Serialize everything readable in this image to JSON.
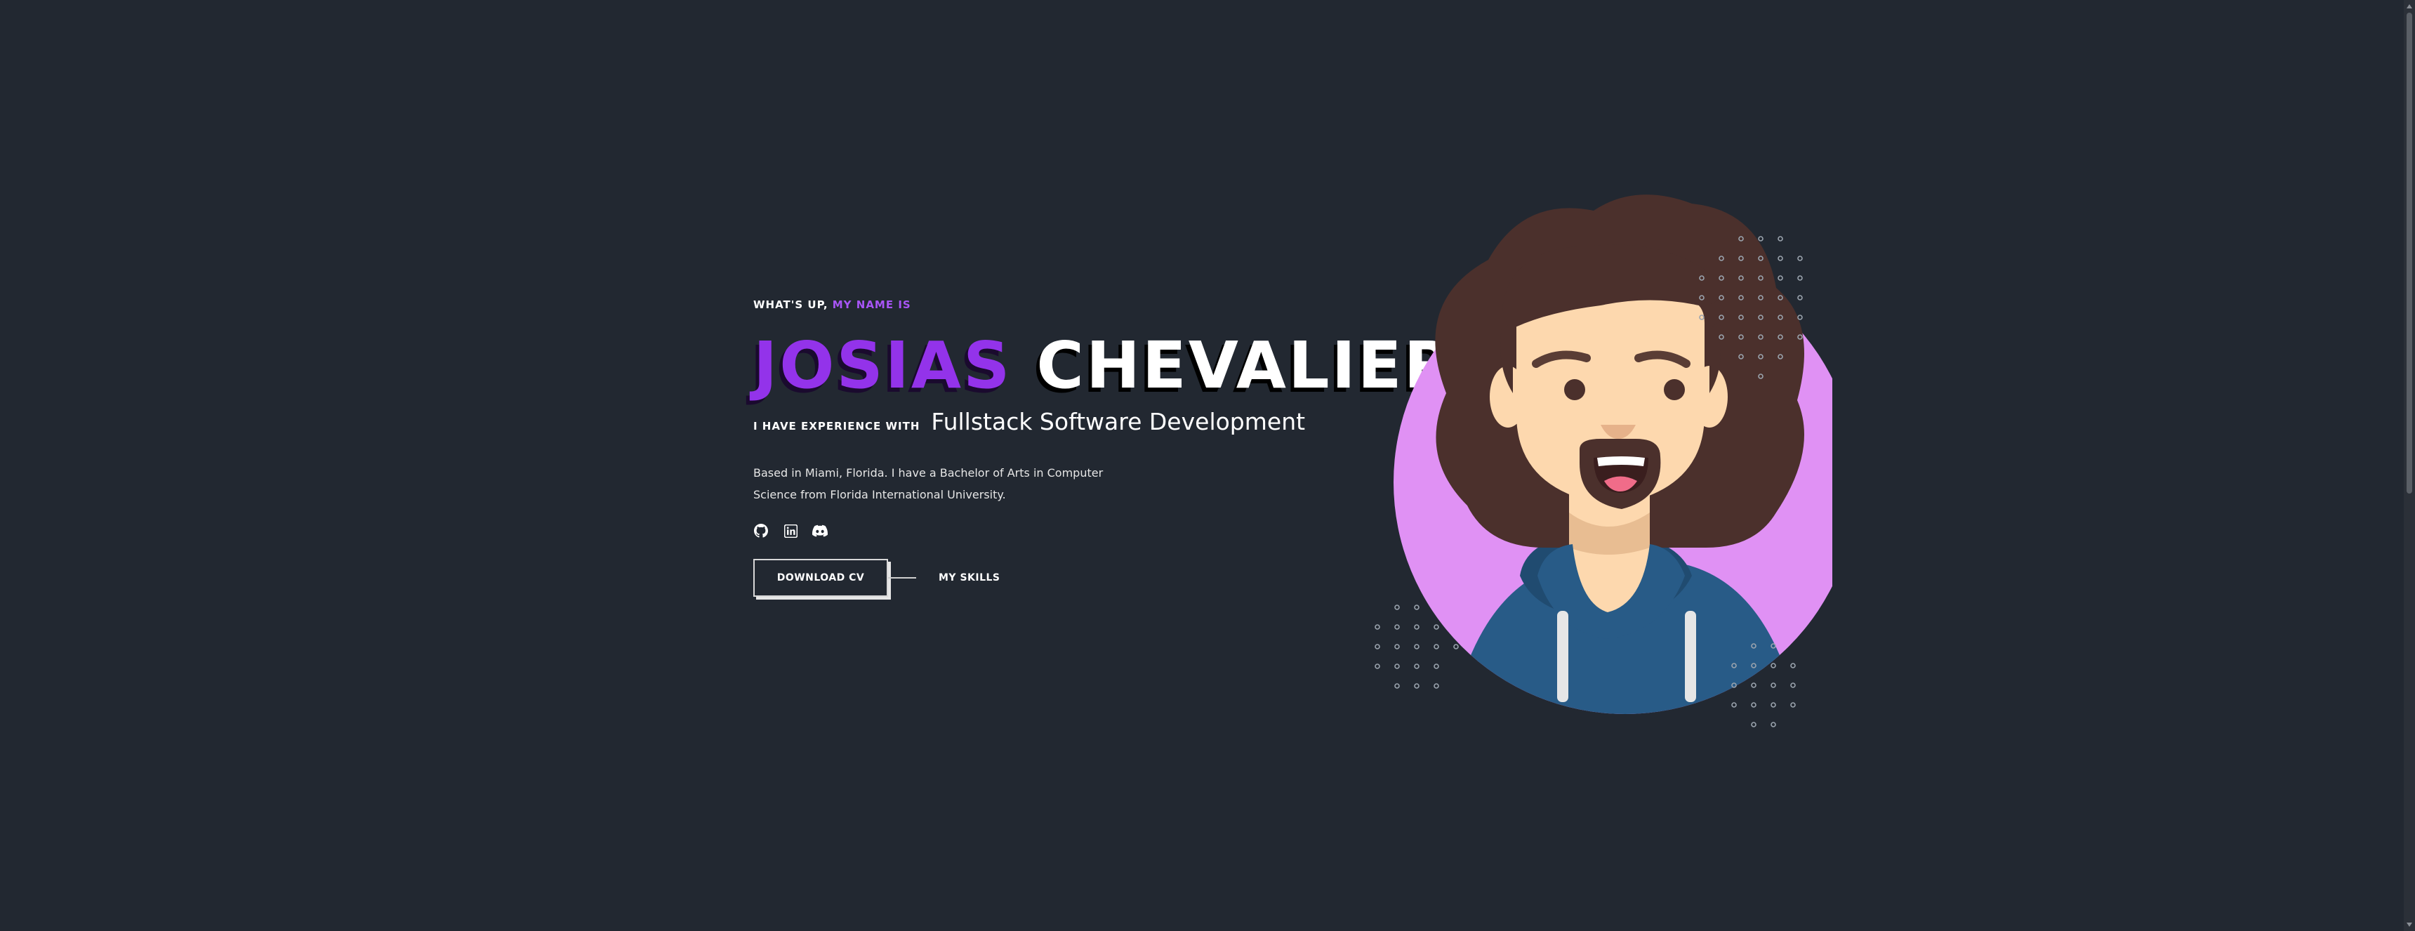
{
  "hero": {
    "greeting_prefix": "WHAT'S UP,",
    "greeting_accent": "MY NAME IS",
    "first_name": "JOSIAS",
    "last_name": "CHEVALIER",
    "experience_label": "I HAVE EXPERIENCE WITH",
    "experience_value": "Fullstack Software Development",
    "bio": "Based in Miami, Florida. I have a Bachelor of Arts in Computer Science from Florida International University."
  },
  "socials": [
    {
      "icon": "github-icon"
    },
    {
      "icon": "linkedin-icon"
    },
    {
      "icon": "discord-icon"
    }
  ],
  "actions": {
    "download_cv_label": "DOWNLOAD CV",
    "skills_label": "MY SKILLS"
  },
  "colors": {
    "background": "#222831",
    "accent": "#a855f7",
    "name_accent": "#9333ea",
    "avatar_circle": "#e091f4",
    "hair": "#4b302c",
    "hoodie": "#285b87"
  }
}
